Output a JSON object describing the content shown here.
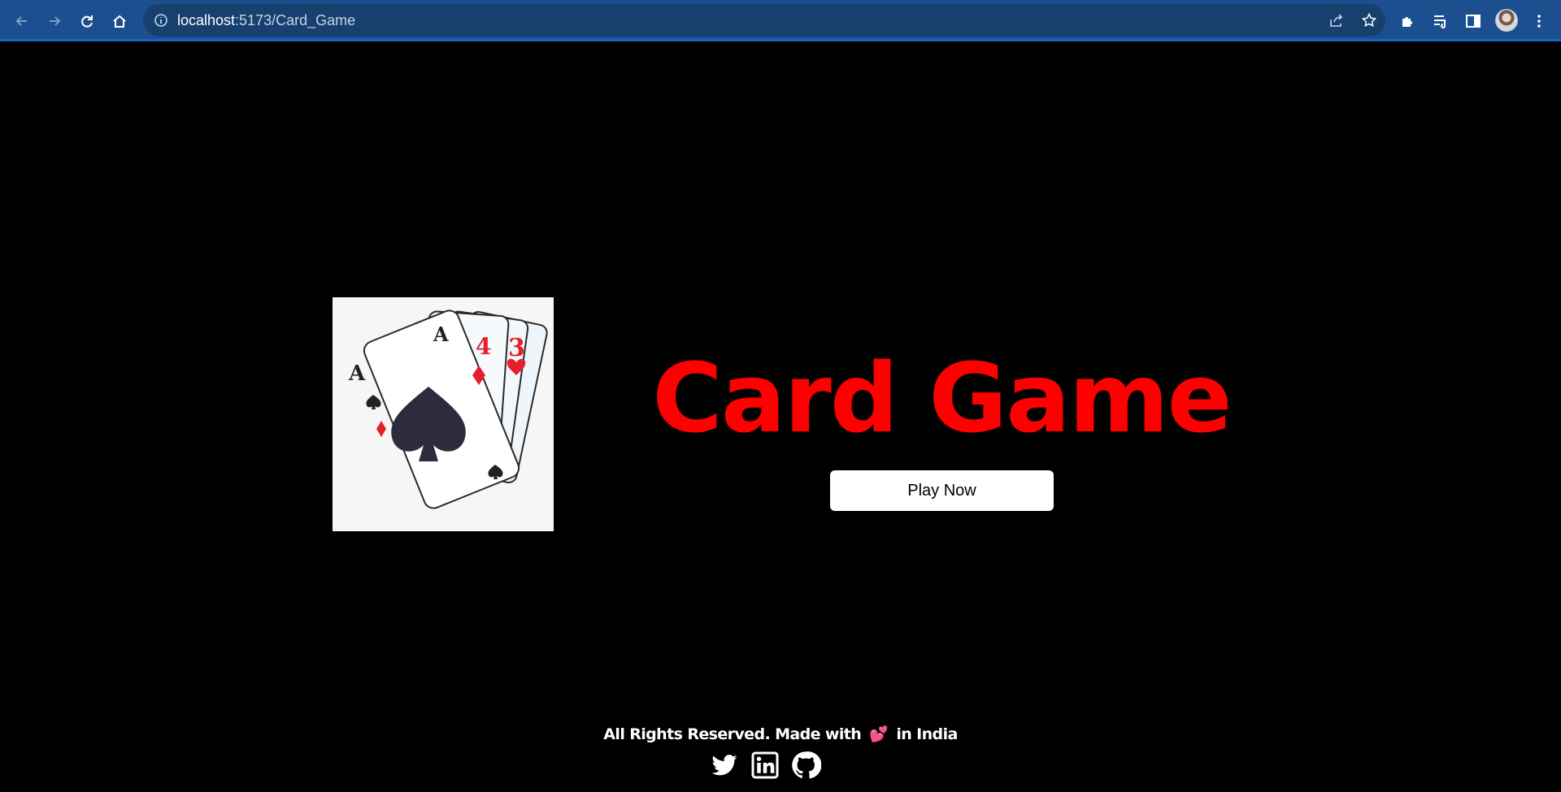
{
  "browser": {
    "url_host": "localhost",
    "url_path": ":5173/Card_Game"
  },
  "page": {
    "title": "Card Game",
    "play_button_label": "Play Now",
    "hero_image_alt": "playing cards icon"
  },
  "footer": {
    "text_before": "All Rights Reserved. Made with",
    "heart": "💕",
    "text_after": "in India",
    "socials": [
      "twitter-icon",
      "linkedin-icon",
      "github-icon"
    ]
  },
  "colors": {
    "title": "#ff0000",
    "background": "#000000",
    "toolbar": "#1b4f8f"
  }
}
